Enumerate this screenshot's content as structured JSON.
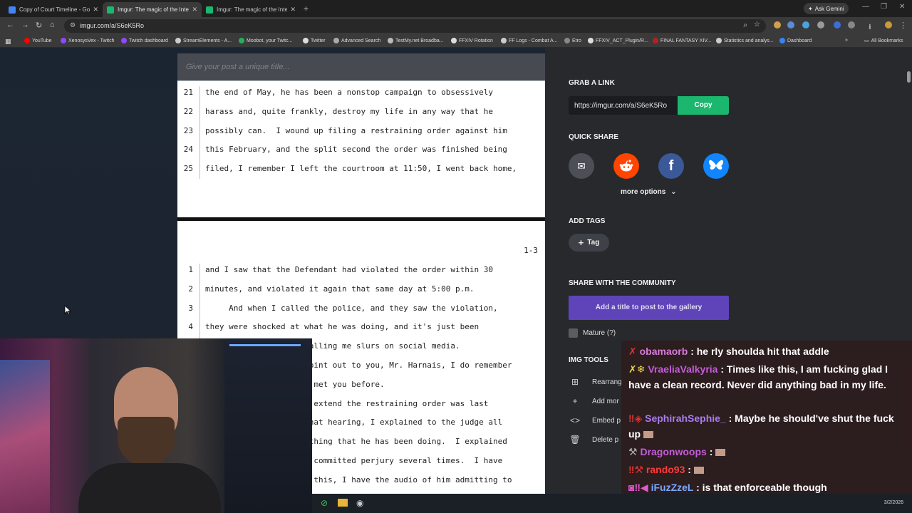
{
  "browser": {
    "tabs": [
      {
        "title": "Copy of Court Timeline - Goog",
        "color": "#4285f4",
        "active": false
      },
      {
        "title": "Imgur: The magic of the Intern",
        "color": "#1bb76e",
        "active": true
      },
      {
        "title": "Imgur: The magic of the Intern",
        "color": "#1bb76e",
        "active": false
      }
    ],
    "ask_gemini": "Ask Gemini",
    "url": "imgur.com/a/S6eK5Ro",
    "bookmarks": [
      {
        "label": "YouTube",
        "color": "#ff0000"
      },
      {
        "label": "XenosysVex - Twitch",
        "color": "#9146ff"
      },
      {
        "label": "Twitch dashboard",
        "color": "#9146ff"
      },
      {
        "label": "StreamElements - A...",
        "color": "#cccccc"
      },
      {
        "label": "Moobot, your Twitc...",
        "color": "#27ae60"
      },
      {
        "label": "Twitter",
        "color": "#dddddd"
      },
      {
        "label": "Advanced Search",
        "color": "#aaaaaa"
      },
      {
        "label": "TestMy.net Broadba...",
        "color": "#bbbbbb"
      },
      {
        "label": "FFXIV Rotation",
        "color": "#dddddd"
      },
      {
        "label": "FF Logs - Combat A...",
        "color": "#cccccc"
      },
      {
        "label": "Etro",
        "color": "#888888"
      },
      {
        "label": "FFXIV_ACT_Plugin/R...",
        "color": "#dddddd"
      },
      {
        "label": "FINAL FANTASY XIV...",
        "color": "#b22222"
      },
      {
        "label": "Statistics and analys...",
        "color": "#cccccc"
      },
      {
        "label": "Dashboard",
        "color": "#3b82f6"
      }
    ],
    "all_bookmarks": "All Bookmarks"
  },
  "post": {
    "title_placeholder": "Give your post a unique title...",
    "page1": {
      "lines": [
        {
          "n": "21",
          "text": "the end of May, he has been a nonstop campaign to obsessively"
        },
        {
          "n": "22",
          "text": "harass and, quite frankly, destroy my life in any way that he"
        },
        {
          "n": "23",
          "text": "possibly can.  I wound up filing a restraining order against him"
        },
        {
          "n": "24",
          "text": "this February, and the split second the order was finished being"
        },
        {
          "n": "25",
          "text": "filed, I remember I left the courtroom at 11:50, I went back home,"
        }
      ]
    },
    "page2": {
      "page_number": "1-3",
      "lines": [
        {
          "n": "1",
          "text": "and I saw that the Defendant had violated the order within 30"
        },
        {
          "n": "2",
          "text": "minutes, and violated it again that same day at 5:00 p.m."
        },
        {
          "n": "3",
          "text": "     And when I called the police, and they saw the violation,"
        },
        {
          "n": "4",
          "text": "they were shocked at what he was doing, and it's just been"
        },
        {
          "n": "",
          "text": "                     calling me slurs on social media."
        },
        {
          "n": "",
          "text": "                     point out to you, Mr. Harnais, I do remember"
        },
        {
          "n": "",
          "text": "                     e met you before."
        },
        {
          "n": "",
          "text": "                     o extend the restraining order was last"
        },
        {
          "n": "",
          "text": "                     that hearing, I explained to the judge all"
        },
        {
          "n": "",
          "text": "                     ything that he has been doing.  I explained"
        },
        {
          "n": "",
          "text": "                     s committed perjury several times.  I have"
        },
        {
          "n": "",
          "text": "                     g this, I have the audio of him admitting to"
        }
      ]
    }
  },
  "sidebar": {
    "grab_link_heading": "GRAB A LINK",
    "link_value": "https://imgur.com/a/S6eK5Ro",
    "copy_label": "Copy",
    "quick_share_heading": "QUICK SHARE",
    "more_options": "more options",
    "add_tags_heading": "ADD TAGS",
    "tag_label": "Tag",
    "community_heading": "SHARE WITH THE COMMUNITY",
    "gallery_button": "Add a title to post to the gallery",
    "mature_label": "Mature (?)",
    "img_tools_heading": "IMG TOOLS",
    "tools": [
      {
        "label": "Rearrang",
        "icon": "rearrange-icon"
      },
      {
        "label": "Add mor",
        "icon": "plus-icon"
      },
      {
        "label": "Embed p",
        "icon": "embed-icon"
      },
      {
        "label": "Delete p",
        "icon": "trash-icon"
      }
    ]
  },
  "chat": {
    "messages": [
      {
        "user": "obamaorb",
        "color": "#d77bd9",
        "text": ": he rly shoulda hit that addle"
      },
      {
        "user": "VraeliaValkyria",
        "color": "#c45dd8",
        "text": ": Times like this, I am fucking glad I have a clean record. Never did anything bad in my life."
      },
      {
        "user": "SephirahSephie_",
        "color": "#a97cf0",
        "text": ": Maybe he should've shut the fuck up"
      },
      {
        "user": "Dragonwoops",
        "color": "#c45dd8",
        "text": ":"
      },
      {
        "user": "rando93",
        "color": "#ff3b3b",
        "text": ":"
      },
      {
        "user": "iFuzZzeL",
        "color": "#7aa8ff",
        "text": ": is that enforceable though"
      }
    ]
  },
  "taskbar": {
    "date": "3/2/2026"
  }
}
